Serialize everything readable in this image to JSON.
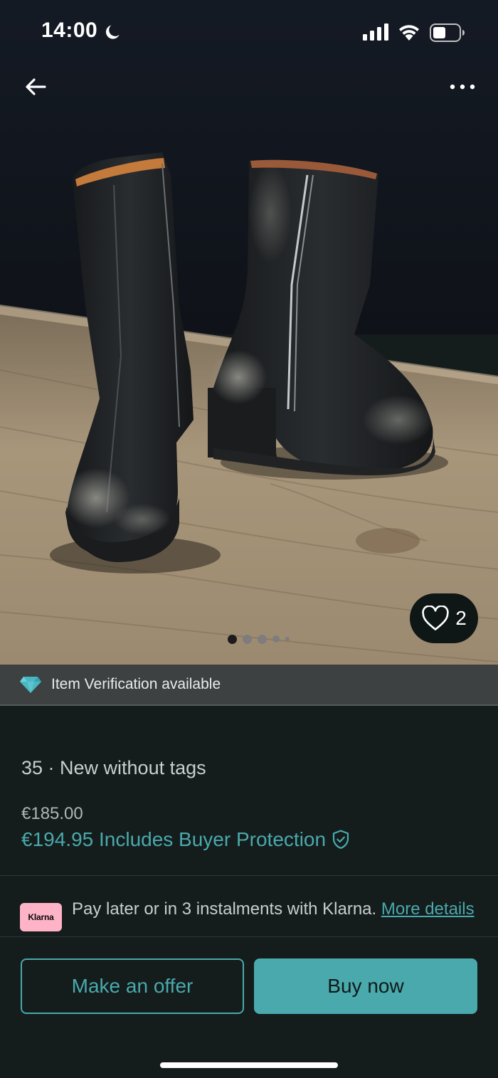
{
  "status_bar": {
    "time": "14:00",
    "icons": [
      "moon-icon",
      "signal-icon",
      "wifi-icon",
      "battery-icon"
    ]
  },
  "nav": {
    "back_icon": "arrow-left-icon",
    "more_icon": "more-dots-icon"
  },
  "gallery": {
    "favourites_count": "2",
    "dot_count": 5,
    "active_dot": 0
  },
  "verification": {
    "text": "Item Verification available",
    "icon": "diamond-icon"
  },
  "item": {
    "size_condition": "35 · New without tags",
    "price": "€185.00",
    "price_total": "€194.95 Includes Buyer Protection",
    "protection_icon": "shield-check-icon"
  },
  "klarna": {
    "logo_text": "Klarna",
    "text": "Pay later or in 3 instalments with Klarna. ",
    "link": "More details"
  },
  "actions": {
    "offer_label": "Make an offer",
    "buy_label": "Buy now"
  },
  "colors": {
    "accent": "#4aa9ac",
    "background": "#141c1c",
    "klarna_pink": "#ffb3c7",
    "verify_bar": "#3d4142"
  }
}
